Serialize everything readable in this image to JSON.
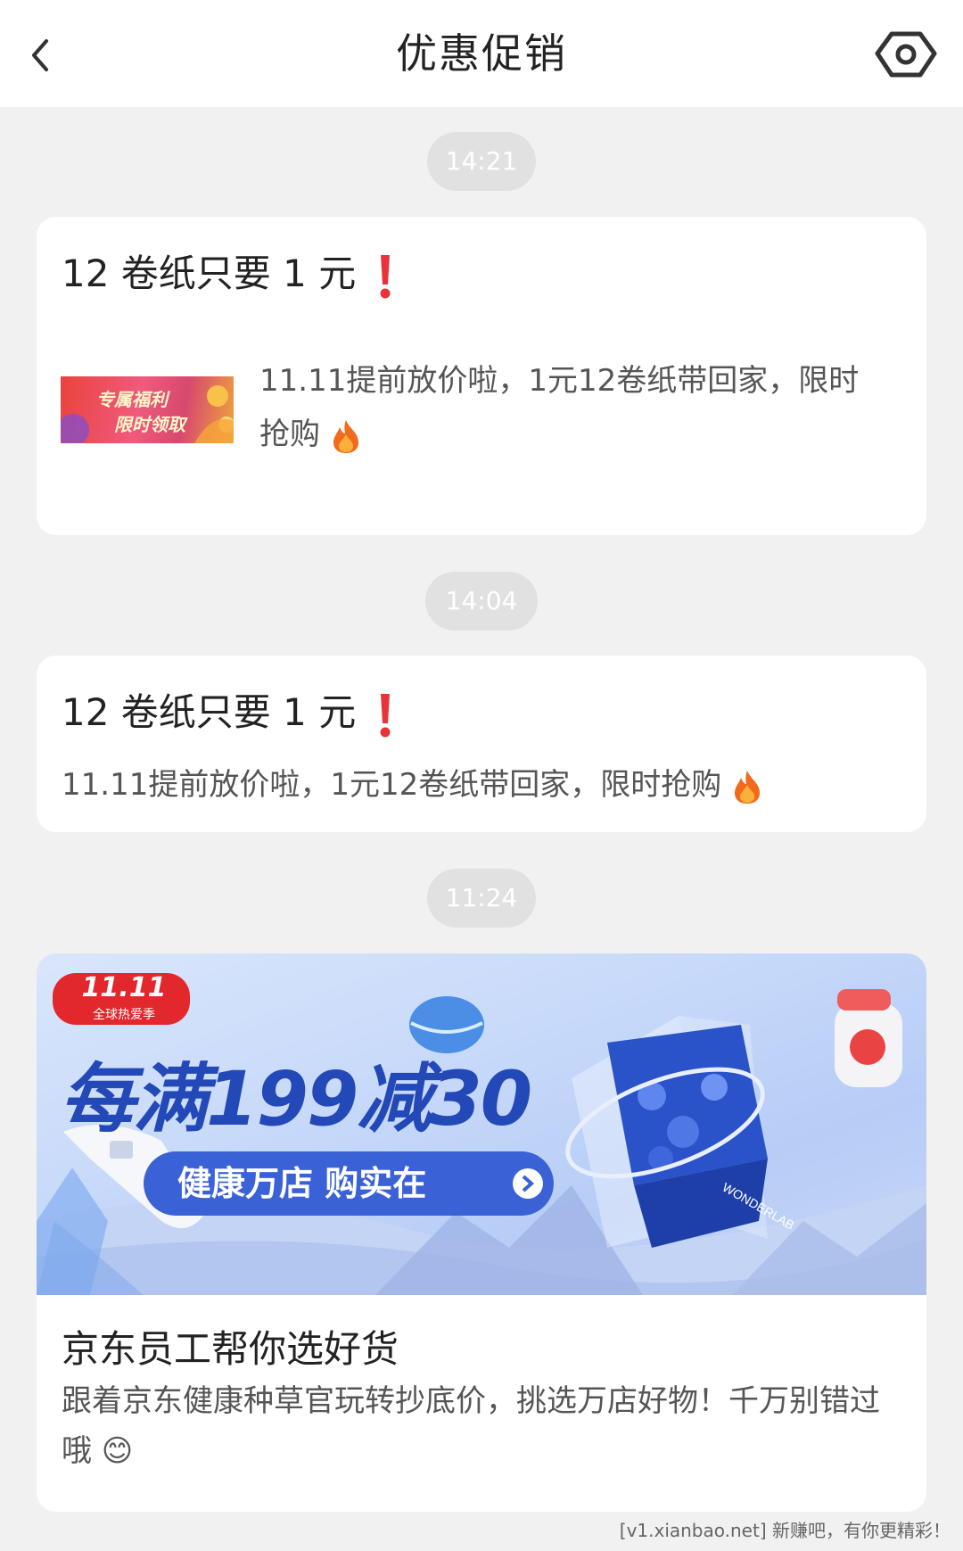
{
  "header": {
    "title": "优惠促销",
    "back_icon": "chevron-left-icon",
    "settings_icon": "hexagon-gear-icon"
  },
  "messages": [
    {
      "time": "14:21",
      "title": "12 卷纸只要 1 元",
      "desc": "11.11提前放价啦，1元12卷纸带回家，限时抢购",
      "thumbnail": {
        "line1": "专属福利",
        "line2": "限时领取"
      }
    },
    {
      "time": "14:04",
      "title": "12 卷纸只要 1 元",
      "desc": "11.11提前放价啦，1元12卷纸带回家，限时抢购"
    },
    {
      "time": "11:24",
      "banner": {
        "badge_top": "11.11",
        "badge_bottom": "全球热爱季",
        "headline": "每满199减30",
        "cta": "健康万店 购实在",
        "product_label": "WONDERLAB"
      },
      "title": "京东员工帮你选好货",
      "desc": "跟着京东健康种草官玩转抄底价，挑选万店好物！千万别错过哦 😊"
    }
  ],
  "watermark": "[v1.xianbao.net] 新赚吧，有你更精彩！",
  "colors": {
    "background": "#f1f1f1",
    "card": "#ffffff",
    "time_pill": "#e1e1e1",
    "accent_red": "#e8333a",
    "banner_blue": "#2a52c9"
  }
}
